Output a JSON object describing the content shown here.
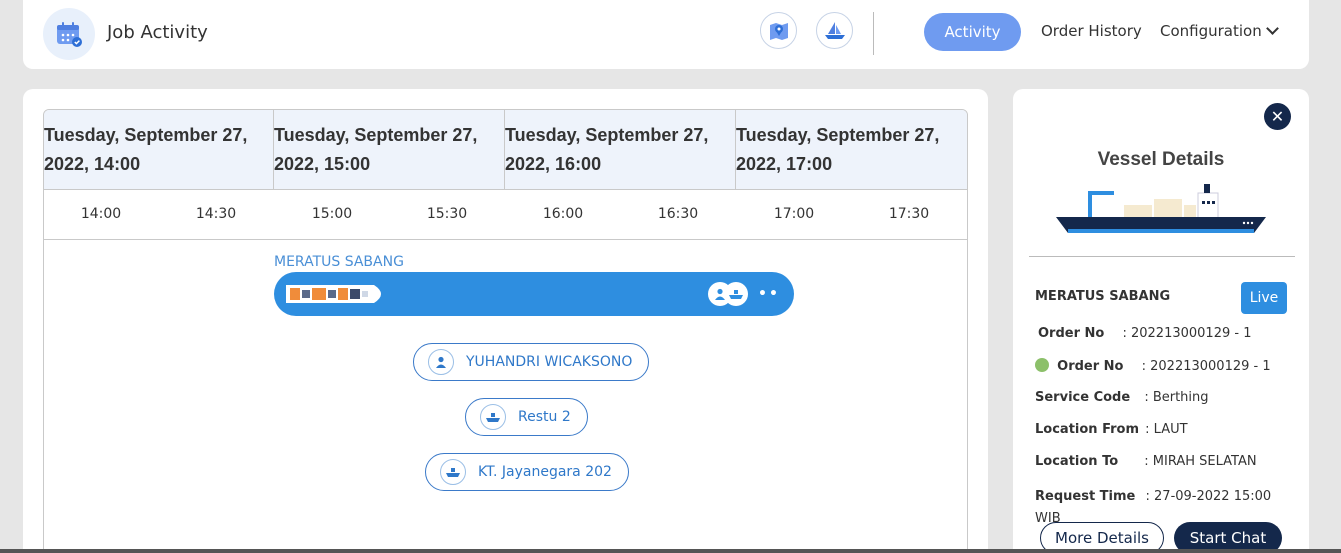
{
  "header": {
    "title": "Job Activity",
    "icons": [
      "calendar-check-icon",
      "map-pin-icon",
      "ship-icon"
    ],
    "nav": {
      "active": "Activity",
      "order_history": "Order History",
      "configuration": "Configuration"
    }
  },
  "timeline": {
    "days": [
      "Tuesday, September 27, 2022, 14:00",
      "Tuesday, September 27, 2022, 15:00",
      "Tuesday, September 27, 2022, 16:00",
      "Tuesday, September 27, 2022, 17:00"
    ],
    "times": [
      "14:00",
      "14:30",
      "15:00",
      "15:30",
      "16:00",
      "16:30",
      "17:00",
      "17:30"
    ],
    "vessel": "MERATUS SABANG",
    "dots": "••",
    "chips": [
      {
        "label": "YUHANDRI WICAKSONO",
        "icon": "person-icon"
      },
      {
        "label": "Restu 2",
        "icon": "boat-icon"
      },
      {
        "label": "KT. Jayanegara 202",
        "icon": "boat-icon"
      }
    ]
  },
  "details": {
    "title": "Vessel Details",
    "vessel_name": "MERATUS SABANG",
    "status": "Live",
    "rows": [
      {
        "label": "Order No",
        "value": ": 202213000129 - 1"
      },
      {
        "label": "Order No",
        "value": ": 202213000129 - 1"
      },
      {
        "label": "Service Code",
        "value": ": Berthing"
      },
      {
        "label": "Location From",
        "value": ": LAUT"
      },
      {
        "label": "Location To",
        "value": ": MIRAH SELATAN"
      },
      {
        "label": "Request Time",
        "value": ": 27-09-2022 15:00 WIB"
      }
    ],
    "more_details": "More Details",
    "start_chat": "Start Chat"
  },
  "colors": {
    "accent": "#2e8ee0",
    "nav_active": "#6f9bf0",
    "dark": "#14284b"
  }
}
